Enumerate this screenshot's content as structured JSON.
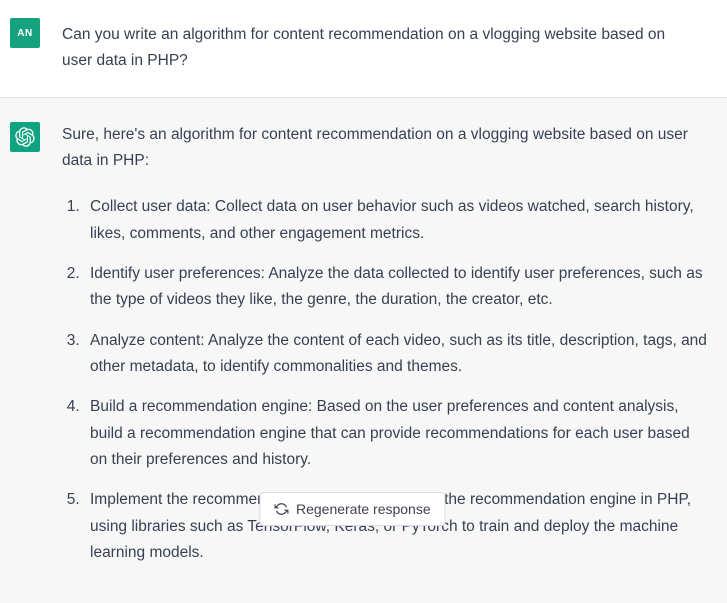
{
  "user": {
    "avatar_text": "AN",
    "message": "Can you write an algorithm for content recommendation on a vlogging website based on user data in PHP?"
  },
  "assistant": {
    "intro": "Sure, here's an algorithm for content recommendation on a vlogging website based on user data in PHP:",
    "steps": [
      "Collect user data: Collect data on user behavior such as videos watched, search history, likes, comments, and other engagement metrics.",
      "Identify user preferences: Analyze the data collected to identify user preferences, such as the type of videos they like, the genre, the duration, the creator, etc.",
      "Analyze content: Analyze the content of each video, such as its title, description, tags, and other metadata, to identify commonalities and themes.",
      "Build a recommendation engine: Based on the user preferences and content analysis, build a recommendation engine that can provide recommendations for each user based on their preferences and history.",
      "Implement the recommendation engine: Implement the recommendation engine in PHP, using libraries such as TensorFlow, Keras, or PyTorch to train and deploy the machine learning models."
    ]
  },
  "regenerate": {
    "label": "Regenerate response"
  }
}
